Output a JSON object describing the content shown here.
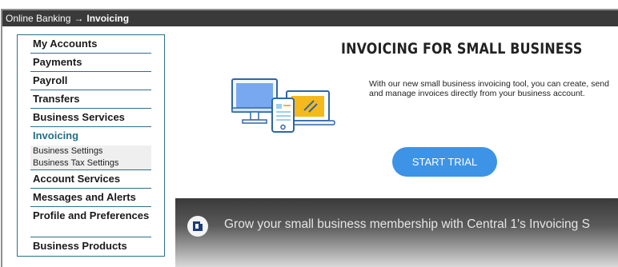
{
  "breadcrumb": {
    "root": "Online Banking",
    "separator": "→",
    "current": "Invoicing"
  },
  "sidebar": {
    "items": [
      {
        "label": "My Accounts"
      },
      {
        "label": "Payments"
      },
      {
        "label": "Payroll"
      },
      {
        "label": "Transfers"
      },
      {
        "label": "Business Services"
      },
      {
        "label": "Invoicing"
      },
      {
        "label": "Account Services"
      },
      {
        "label": "Messages and Alerts"
      },
      {
        "label": "Profile and Preferences"
      },
      {
        "label": "Business Products"
      }
    ],
    "subitems": [
      {
        "label": "Business Settings"
      },
      {
        "label": "Business Tax Settings"
      }
    ]
  },
  "main": {
    "title": "INVOICING FOR SMALL BUSINESS",
    "description": "With our new small business invoicing tool, you can create, send and manage invoices directly from your business account.",
    "cta_label": "START TRIAL"
  },
  "video": {
    "title": "Grow your small business membership with Central 1's Invoicing S"
  },
  "colors": {
    "accent": "#3d93e6",
    "nav_border": "#2b6f8a",
    "active_nav": "#1f6f87",
    "topbar": "#3a3a3a"
  }
}
